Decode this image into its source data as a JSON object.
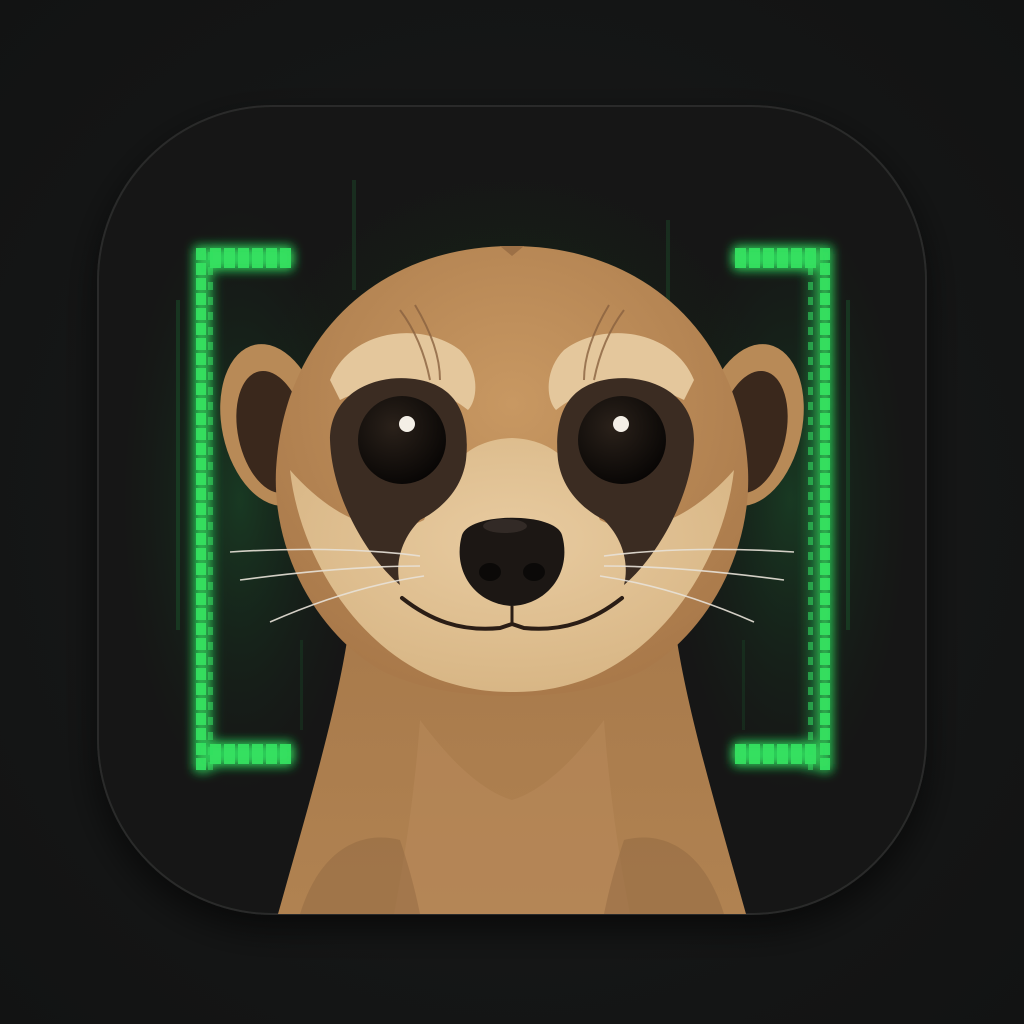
{
  "app_icon": {
    "subject": "meerkat",
    "frame_style": "pixel terminal brackets",
    "colors": {
      "page_background": "#141515",
      "tile_background": "#151715",
      "tile_border": "#2a2c2a",
      "bracket_green": "#34e060",
      "bracket_glow": "#1fa84a",
      "fur_main": "#b98a57",
      "fur_light": "#e2c296",
      "fur_shadow": "#8e6640",
      "eye_patch": "#3b2c22",
      "eye": "#0d0a08",
      "nose": "#1c1714"
    },
    "icons": [
      "meerkat-icon",
      "left-bracket-icon",
      "right-bracket-icon"
    ]
  }
}
